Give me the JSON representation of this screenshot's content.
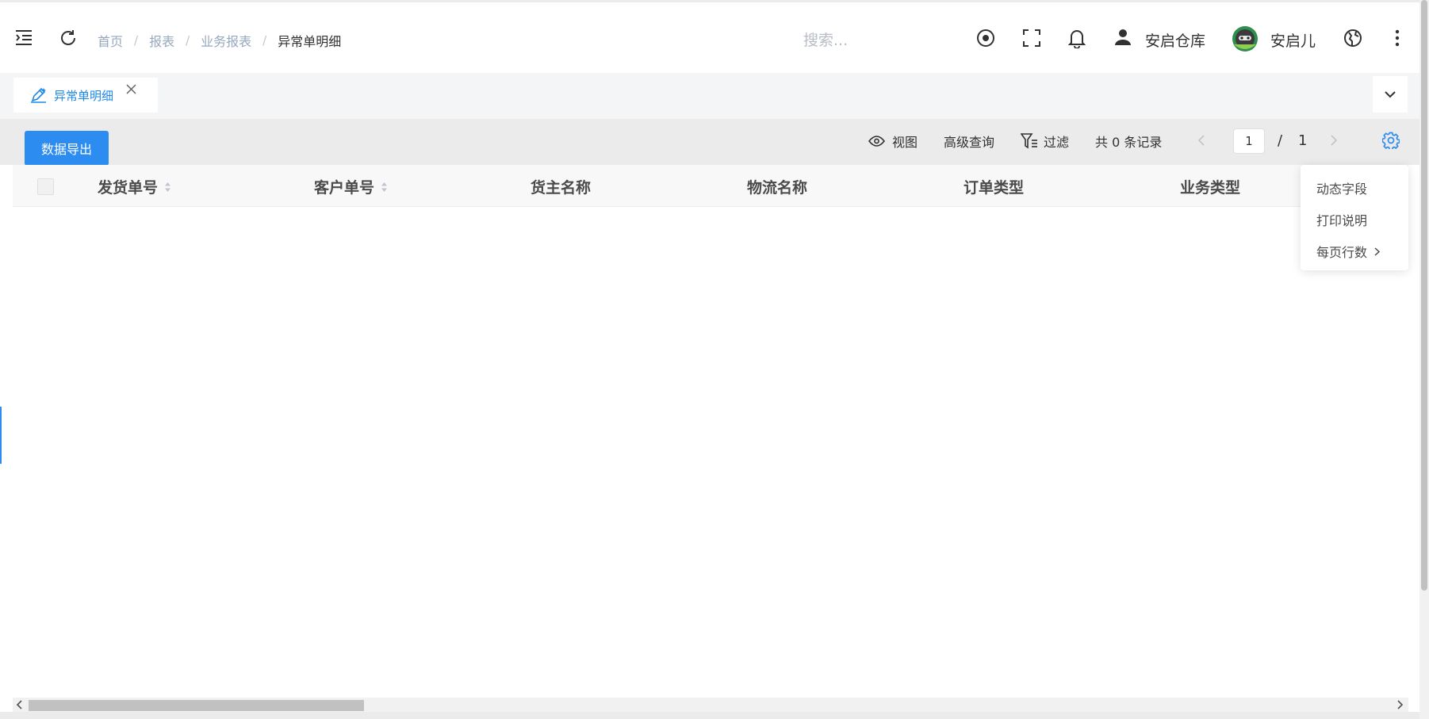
{
  "breadcrumb": {
    "items": [
      "首页",
      "报表",
      "业务报表"
    ],
    "current": "异常单明细",
    "separator": "/"
  },
  "search": {
    "placeholder": "搜索..."
  },
  "header": {
    "warehouse": "安启仓库",
    "username": "安启儿"
  },
  "tabs": [
    {
      "label": "异常单明细",
      "active": true
    }
  ],
  "toolbar": {
    "export_label": "数据导出",
    "view_label": "视图",
    "advanced_query_label": "高级查询",
    "filter_label": "过滤",
    "record_count": "共 0 条记录",
    "current_page": "1",
    "page_separator": "/",
    "total_pages": "1"
  },
  "table": {
    "columns": [
      "发货单号",
      "客户单号",
      "货主名称",
      "物流名称",
      "订单类型",
      "业务类型"
    ],
    "rows": []
  },
  "settings_menu": {
    "items": [
      "动态字段",
      "打印说明",
      "每页行数"
    ]
  },
  "colors": {
    "accent": "#2d8cf0",
    "tab_text": "#1e88e5",
    "header_text": "#4a4a4a"
  },
  "icons": [
    "menu-fold-icon",
    "refresh-icon",
    "target-icon",
    "fullscreen-icon",
    "bell-icon",
    "user-icon",
    "globe-icon",
    "more-vertical-icon",
    "edit-icon",
    "close-icon",
    "chevron-down-icon",
    "eye-icon",
    "filter-icon",
    "chevron-left-icon",
    "chevron-right-icon",
    "gear-icon"
  ]
}
